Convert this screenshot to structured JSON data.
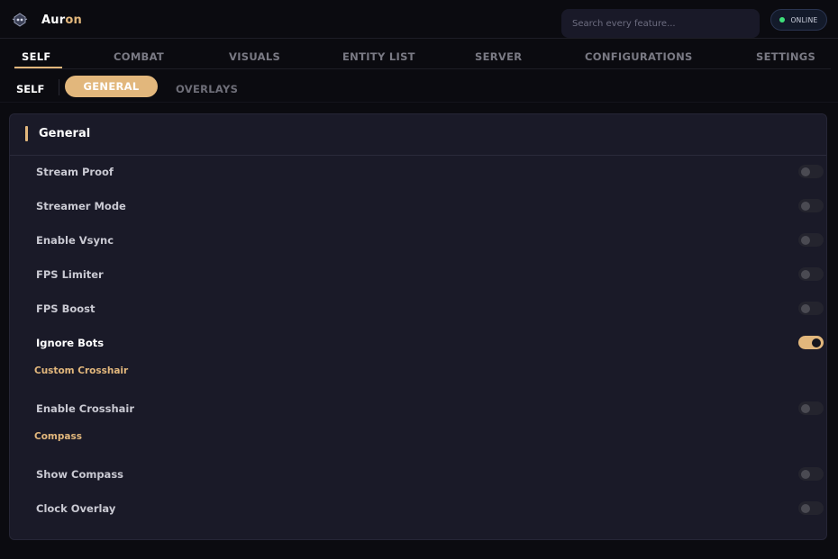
{
  "app": {
    "brand_main": "Aur",
    "brand_accent": "on",
    "logo_icon": "robot-head-icon"
  },
  "search": {
    "placeholder": "Search every feature..."
  },
  "status": {
    "label": "ONLINE",
    "color": "#3ee07a"
  },
  "tabs": [
    {
      "label": "SELF",
      "active": true
    },
    {
      "label": "COMBAT"
    },
    {
      "label": "VISUALS"
    },
    {
      "label": "ENTITY LIST"
    },
    {
      "label": "SERVER"
    },
    {
      "label": "CONFIGURATIONS"
    },
    {
      "label": "SETTINGS"
    }
  ],
  "subtabs": {
    "section": "SELF",
    "items": [
      {
        "label": "GENERAL",
        "active": true
      },
      {
        "label": "OVERLAYS"
      }
    ]
  },
  "panel": {
    "title": "General",
    "rows": [
      {
        "label": "Stream Proof",
        "on": false
      },
      {
        "label": "Streamer Mode",
        "on": false
      },
      {
        "label": "Enable Vsync",
        "on": false
      },
      {
        "label": "FPS Limiter",
        "on": false
      },
      {
        "label": "FPS Boost",
        "on": false
      },
      {
        "label": "Ignore Bots",
        "on": true
      }
    ],
    "sections": [
      {
        "title": "Custom Crosshair",
        "rows": [
          {
            "label": "Enable Crosshair",
            "on": false
          }
        ]
      },
      {
        "title": "Compass",
        "rows": [
          {
            "label": "Show Compass",
            "on": false
          },
          {
            "label": "Clock Overlay",
            "on": false
          }
        ]
      }
    ]
  },
  "colors": {
    "accent": "#e2b77c",
    "background": "#0b0b10",
    "panel": "#1a1a28"
  }
}
